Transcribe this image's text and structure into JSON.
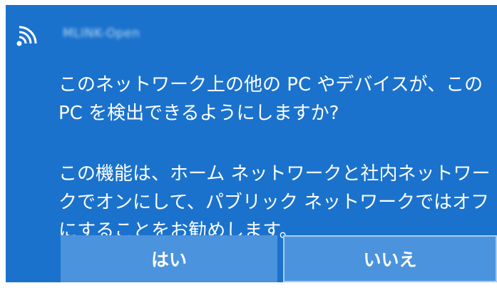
{
  "notification": {
    "network_name": "MLINK-Open",
    "question": "このネットワーク上の他の PC やデバイスが、この PC を検出できるようにしますか?",
    "info": "この機能は、ホーム ネットワークと社内ネットワークでオンにして、パブリック ネットワークではオフにすることをお勧めします。"
  },
  "buttons": {
    "yes_label": "はい",
    "no_label": "いいえ"
  },
  "icons": {
    "network": "wifi-icon"
  },
  "colors": {
    "panel_bg": "#1a72cc",
    "button_bg": "#4b93dd",
    "focus_border": "#a8cdf2"
  }
}
